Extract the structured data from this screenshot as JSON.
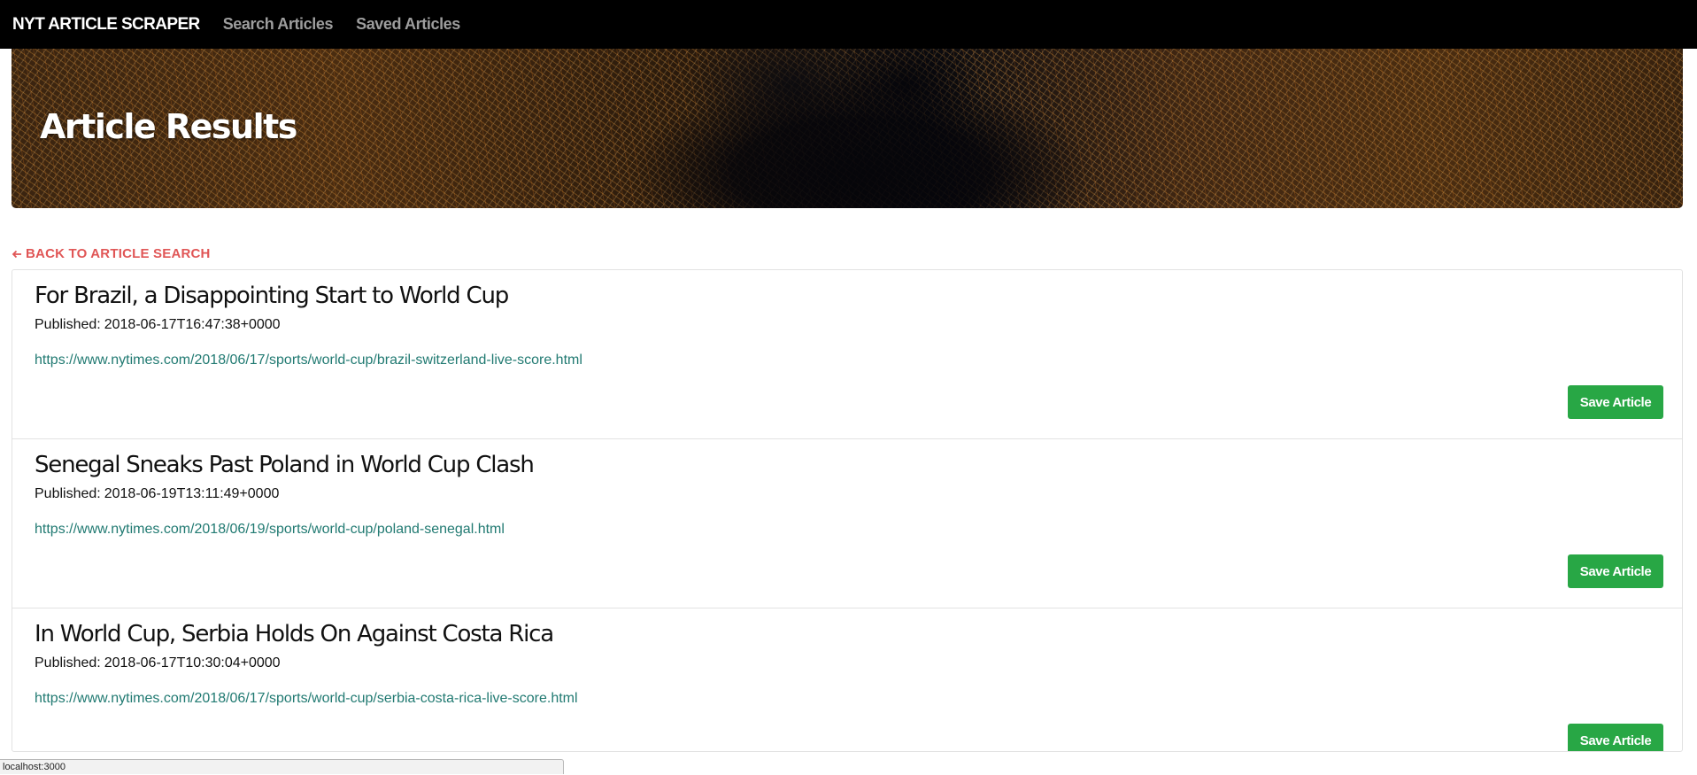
{
  "navbar": {
    "brand": "NYT ARTICLE SCRAPER",
    "links": [
      "Search Articles",
      "Saved Articles"
    ]
  },
  "hero": {
    "title": "Article Results"
  },
  "back_link": {
    "icon": "arrow-left-icon",
    "label": "BACK TO ARTICLE SEARCH"
  },
  "articles": [
    {
      "title": "For Brazil, a Disappointing Start to World Cup",
      "published_label": "Published:",
      "published": "2018-06-17T16:47:38+0000",
      "url": "https://www.nytimes.com/2018/06/17/sports/world-cup/brazil-switzerland-live-score.html",
      "save_label": "Save Article"
    },
    {
      "title": "Senegal Sneaks Past Poland in World Cup Clash",
      "published_label": "Published:",
      "published": "2018-06-19T13:11:49+0000",
      "url": "https://www.nytimes.com/2018/06/19/sports/world-cup/poland-senegal.html",
      "save_label": "Save Article"
    },
    {
      "title": "In World Cup, Serbia Holds On Against Costa Rica",
      "published_label": "Published:",
      "published": "2018-06-17T10:30:04+0000",
      "url": "https://www.nytimes.com/2018/06/17/sports/world-cup/serbia-costa-rica-live-score.html",
      "save_label": "Save Article"
    }
  ],
  "status_bar": {
    "url": "localhost:3000"
  },
  "colors": {
    "navbar_bg": "#000000",
    "nav_link": "#9d9d9d",
    "back_link": "#e05656",
    "link": "#217a72",
    "save_button": "#28a745"
  }
}
